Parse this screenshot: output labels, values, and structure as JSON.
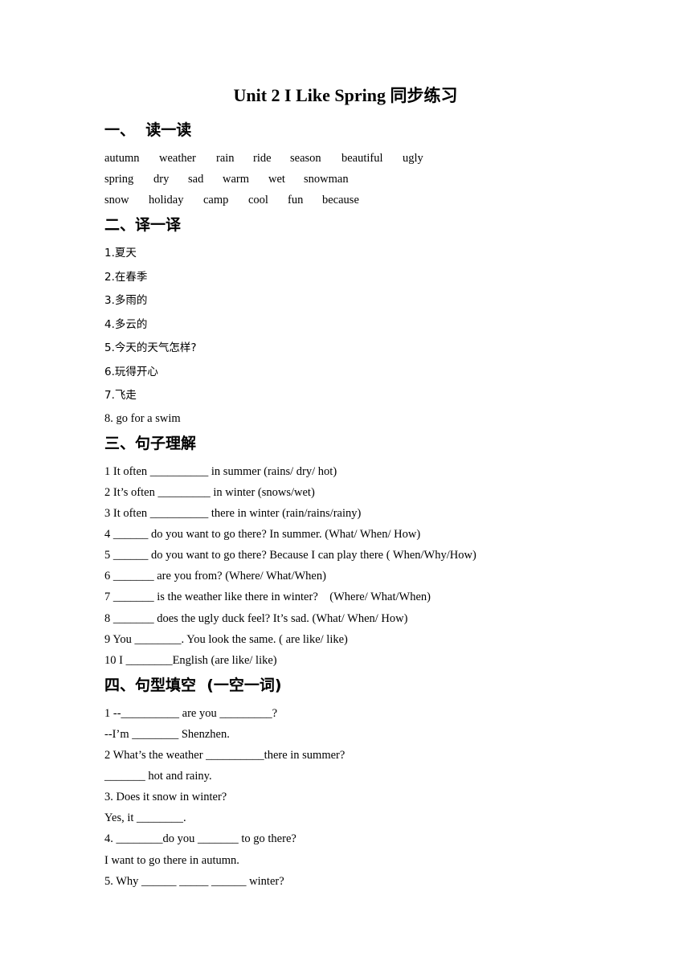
{
  "document": {
    "title_en": "Unit 2 I Like Spring ",
    "title_cn": "同步练习"
  },
  "section1": {
    "heading": "一、  读一读",
    "word_rows": [
      [
        "autumn",
        "weather",
        "rain",
        "ride",
        "season",
        "beautiful",
        "ugly"
      ],
      [
        "spring",
        "dry",
        "sad",
        "warm",
        "wet",
        "snowman"
      ],
      [
        "snow",
        "holiday",
        "camp",
        "cool",
        "fun",
        "because"
      ]
    ]
  },
  "section2": {
    "heading": "二、译一译",
    "items": [
      "1.夏天",
      "2.在春季",
      "3.多雨的",
      "4.多云的",
      "5.今天的天气怎样?",
      "6.玩得开心",
      "7.飞走",
      "8. go for a swim"
    ]
  },
  "section3": {
    "heading": "三、句子理解",
    "items": [
      "1 It often __________ in summer (rains/ dry/ hot)",
      "2 It’s often _________ in winter (snows/wet)",
      "3 It often __________ there in winter (rain/rains/rainy)",
      "4 ______ do you want to go there? In summer. (What/ When/ How)",
      "5 ______ do you want to go there? Because I can play there ( When/Why/How)",
      "6 _______ are you from? (Where/ What/When)",
      "7 _______ is the weather like there in winter?    (Where/ What/When)",
      "8 _______ does the ugly duck feel? It’s sad. (What/ When/ How)",
      "9 You ________. You look the same. ( are like/ like)",
      "10 I ________English (are like/ like)"
    ]
  },
  "section4": {
    "heading": "四、句型填空  (一空一词)",
    "items": [
      "1 --__________ are you _________?",
      "--I’m ________ Shenzhen.",
      "2 What’s the weather __________there in summer?",
      "_______ hot and rainy.",
      "3. Does it snow in winter?",
      "Yes, it ________.",
      "4. ________do you _______ to go there?",
      "I want to go there in autumn.",
      "5. Why ______ _____ ______ winter?"
    ]
  }
}
